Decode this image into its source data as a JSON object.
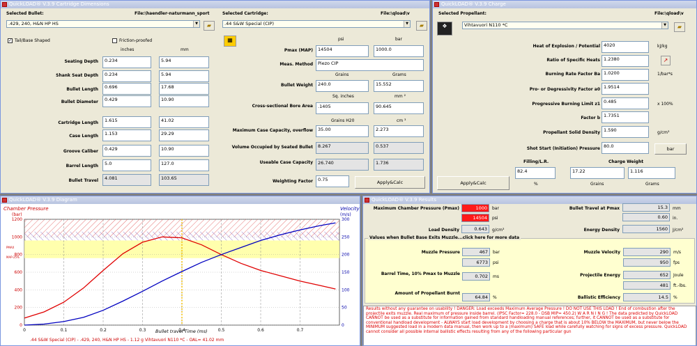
{
  "cartridge": {
    "title": "QuickLOAD® V.3.9 Cartridge Dimensions",
    "bullet_label": "Selected Bullet:",
    "bullet_file": "File:\\haendler-naturmann_sport",
    "bullet_value": ".429, 240, H&N HP HS",
    "cart_label": "Selected Cartridge:",
    "cart_file": "File:\\qload\\v",
    "cart_value": ".44 S&W Special (CIP)",
    "tail": "Tail/Base Shaped",
    "friction": "Friction-proofed",
    "inches": "inches",
    "mm": "mm",
    "rows": [
      {
        "label": "Seating Depth",
        "in": "0.234",
        "mm": "5.94"
      },
      {
        "label": "Shank Seat Depth",
        "in": "0.234",
        "mm": "5.94"
      },
      {
        "label": "Bullet Length",
        "in": "0.696",
        "mm": "17.68"
      },
      {
        "label": "Bullet Diameter",
        "in": "0.429",
        "mm": "10.90"
      },
      {
        "label": "Cartridge Length",
        "in": "1.615",
        "mm": "41.02"
      },
      {
        "label": "Case Length",
        "in": "1.153",
        "mm": "29.29"
      },
      {
        "label": "Groove Caliber",
        "in": "0.429",
        "mm": "10.90"
      },
      {
        "label": "Barrel Length",
        "in": "5.0",
        "mm": "127.0"
      },
      {
        "label": "Bullet Travel",
        "in": "4.081",
        "mm": "103.65"
      }
    ],
    "psi": "psi",
    "bar": "bar",
    "pmax_label": "Pmax (MAP)",
    "pmax_psi": "14504",
    "pmax_bar": "1000.0",
    "meas_label": "Meas. Method",
    "meas_value": "Piezo CIP",
    "grains": "Grains",
    "grams": "Grams",
    "bw_label": "Bullet Weight",
    "bw_gr": "240.0",
    "bw_g": "15.552",
    "sqin": "Sq. inches",
    "mm2": "mm ²",
    "bore_label": "Cross-sectional Bore Area",
    "bore_in": ".1405",
    "bore_mm": "90.645",
    "grainsh2o": "Grains H20",
    "cm3": "cm ³",
    "maxcap_label": "Maximum Case Capacity, overflow",
    "maxcap_gr": "35.00",
    "maxcap_cm": "2.273",
    "occ_label": "Volume Occupied by Seated Bullet",
    "occ_gr": "8.267",
    "occ_cm": "0.537",
    "use_label": "Useable Case Capacity",
    "use_gr": "26.740",
    "use_cm": "1.736",
    "wf_label": "Weighting Factor",
    "wf_value": "0.75",
    "apply": "Apply&Calc"
  },
  "charge": {
    "title": "QuickLOAD® V.3.9 Charge",
    "prop_label": "Selected Propellant:",
    "prop_file": "File:\\qload\\v",
    "prop_value": "Vihtavuori N110 *C",
    "rows": [
      {
        "label": "Heat of Explosion / Potential",
        "value": "4020",
        "unit": "kJ/kg"
      },
      {
        "label": "Ratio of Specific Heats",
        "value": "1.2380",
        "unit": ""
      },
      {
        "label": "Burning Rate Factor  Ba",
        "value": "1.0200",
        "unit": "1/bar*s"
      },
      {
        "label": "Pro- or Degressivity Factor  a0",
        "value": "1.9514",
        "unit": ""
      },
      {
        "label": "Progressive Burning Limit z1",
        "value": "0.485",
        "unit": "x 100%"
      },
      {
        "label": "Factor  b",
        "value": "1.7351",
        "unit": ""
      },
      {
        "label": "Propellant Solid Density",
        "value": "1.590",
        "unit": "g/cm³"
      },
      {
        "label": "Shot Start (Initiation) Pressure",
        "value": "80.0",
        "unit": ""
      }
    ],
    "bar_btn": "bar",
    "filling": "Filling/L.R.",
    "chargew": "Charge Weight",
    "fill_val": "82.4",
    "cw_gr": "17.22",
    "cw_g": "1.116",
    "pct": "%",
    "grains": "Grains",
    "grams": "Grams",
    "apply": "Apply&Calc"
  },
  "diagram": {
    "title": "QuickLOAD® V.3.9 Diagram",
    "y_left_title": "Chamber Pressure",
    "y_left_unit": "(bar)",
    "y_right_title": "Velocity",
    "y_right_unit": "(m/s)",
    "x_title": "Bullet travel Time (ms)",
    "footer": ".44 S&W Special (CIP) - .429, 240, H&N HP HS - 1.12 g Vihtavuori N110 *C - OAL= 41.02 mm",
    "map_label": "MAP-25%",
    "pmax_label": "PMAX",
    "y_left_ticks": [
      "1200",
      "1000",
      "800",
      "600",
      "400",
      "200",
      "0"
    ],
    "y_right_ticks": [
      "300",
      "250",
      "200",
      "150",
      "100",
      "50",
      "0"
    ],
    "x_ticks": [
      "0",
      "0.1",
      "0.2",
      "0.3",
      "0.4",
      "0.5",
      "0.6",
      "0.7"
    ]
  },
  "chart_data": {
    "type": "line",
    "xlabel": "Bullet travel Time (ms)",
    "ylabel": "Chamber Pressure (bar)",
    "y2label": "Velocity (m/s)",
    "xlim": [
      0,
      0.8
    ],
    "ylim": [
      0,
      1200
    ],
    "y2lim": [
      0,
      300
    ],
    "series": [
      {
        "axis": "left",
        "color": "#e00000",
        "x": [
          0,
          0.05,
          0.1,
          0.15,
          0.2,
          0.25,
          0.3,
          0.35,
          0.4,
          0.45,
          0.5,
          0.55,
          0.6,
          0.65,
          0.7,
          0.75,
          0.79
        ],
        "values": [
          80,
          150,
          260,
          420,
          620,
          810,
          940,
          1000,
          990,
          910,
          800,
          700,
          620,
          560,
          500,
          450,
          410
        ]
      },
      {
        "axis": "right",
        "color": "#0000c0",
        "x": [
          0,
          0.05,
          0.1,
          0.15,
          0.2,
          0.25,
          0.3,
          0.35,
          0.4,
          0.45,
          0.5,
          0.55,
          0.6,
          0.65,
          0.7,
          0.75,
          0.79
        ],
        "values": [
          0,
          3,
          10,
          22,
          42,
          68,
          96,
          125,
          152,
          178,
          200,
          220,
          240,
          256,
          270,
          282,
          290
        ]
      }
    ]
  },
  "results": {
    "title": "QuickLOAD® V.3.9 Results",
    "mcp_label": "Maximum Chamber Pressure (Pmax)",
    "mcp_bar": "1000",
    "mcp_psi": "14504",
    "bar": "bar",
    "psi": "psi",
    "ld_label": "Load Density",
    "ld_value": "0.643",
    "ld_unit": "g/cm³",
    "btp_label": "Bullet Travel at Pmax",
    "btp_mm": "15.3",
    "btp_in": "0.60",
    "mm": "mm",
    "in": "in.",
    "ed_label": "Energy Density",
    "ed_value": "1560",
    "ed_unit": "J/cm³",
    "section": "Values when Bullet Base Exits Muzzle...click here for more data",
    "mp_label": "Muzzle Pressure",
    "mp_bar": "467",
    "mp_psi": "6773",
    "mv_label": "Muzzle Velocity",
    "mv_ms": "290",
    "mv_fps": "950",
    "ms": "m/s",
    "fps": "fps",
    "bt_label": "Barrel Time, 10% Pmax to Muzzle",
    "bt_value": "0.702",
    "bt_unit": "ms",
    "pe_label": "Projectile Energy",
    "pe_joule": "652",
    "pe_ftlbs": "481",
    "joule": "Joule",
    "ftlbs": "ft.-lbs.",
    "apb_label": "Amount of Propellant Burnt",
    "apb_value": "64.84",
    "be_label": "Ballistic Efficiency",
    "be_value": "14.5",
    "pct": "%",
    "warning": "Results without any guarantee on usability ! DANGER: Load exceeds Maximum Average Pressure ! DO NOT USE THIS LOAD !   End of combustion after the projectile exits muzzle.  Real maximum of pressure inside barrel.  (IPSC Factor= 228.0 - DSB MIP= 450.2)   W A R N I N G !  The data predicted by QuickLOAD CANNOT be used as a substitute for information gained from standard handloading manual references; further, it CANNOT be used as a substitute for conventional handload development - ALWAYS start load development by choosing a charge that is about 10% BELOW the MAXIMUM, but never below the MINIMUM suggested load in a modern data manual, then work up to a (maximum) SAFE load while carefully watching for signs of excess pressure. QuickLOAD cannot consider all possible internal ballistic effects resulting from any of the following particular gun"
  },
  "icons": {
    "folder": "folder-icon",
    "cartridge": "cartridge-icon",
    "propellant": "propellant-icon",
    "chart": "chart-icon"
  }
}
